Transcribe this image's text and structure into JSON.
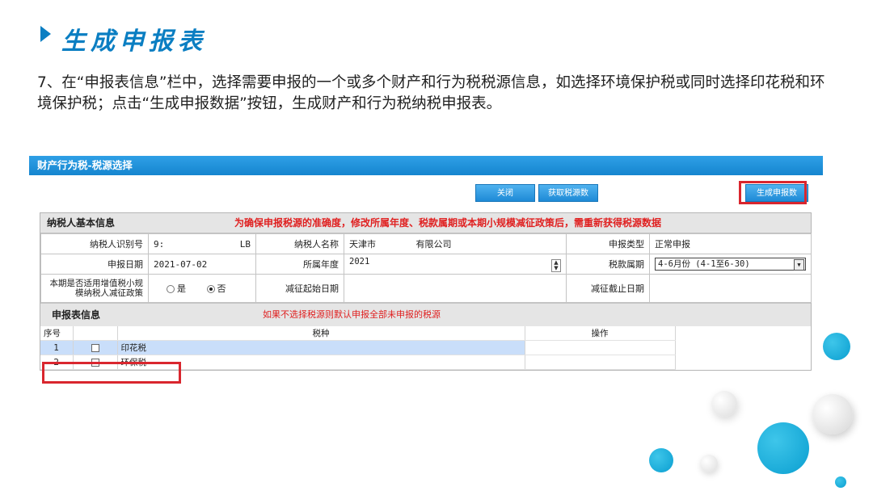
{
  "slide": {
    "title": "生成申报表",
    "description": "7、在“申报表信息”栏中，选择需要申报的一个或多个财产和行为税税源信息，如选择环境保护税或同时选择印花税和环境保护税；点击“生成申报数据”按钮，生成财产和行为税纳税申报表。"
  },
  "window": {
    "title": "财产行为税-税源选择",
    "buttons": {
      "close": "关闭",
      "fetch": "获取税源数据",
      "generate": "生成申报数据"
    }
  },
  "taxpayer": {
    "section_title": "纳税人基本信息",
    "warning": "为确保申报税源的准确度，修改所属年度、税款属期或本期小规模减征政策后，需重新获得税源数据",
    "id_label": "纳税人识别号",
    "id_value_prefix": "9:",
    "id_value_suffix": "LB",
    "name_label": "纳税人名称",
    "name_value_city": "天津市",
    "name_value_company": "有限公司",
    "declare_type_label": "申报类型",
    "declare_type_value": "正常申报",
    "date_label": "申报日期",
    "date_value": "2021-07-02",
    "year_label": "所属年度",
    "year_value": "2021",
    "period_label": "税款属期",
    "period_value": "4-6月份 (4-1至6-30)",
    "policy_label": "本期是否适用增值税小规模纳税人减征政策",
    "policy_yes": "是",
    "policy_no": "否",
    "policy_selected": "否",
    "reduce_start_label": "减征起始日期",
    "reduce_start_value": "",
    "reduce_end_label": "减征截止日期",
    "reduce_end_value": ""
  },
  "declaration": {
    "section_title": "申报表信息",
    "note": "如果不选择税源则默认申报全部未申报的税源",
    "columns": {
      "seq": "序号",
      "tax_type": "税种",
      "action": "操作"
    },
    "rows": [
      {
        "seq": "1",
        "tax_type": "印花税",
        "checked": false,
        "selected": true
      },
      {
        "seq": "2",
        "tax_type": "环保税",
        "checked": false,
        "selected": false
      }
    ]
  },
  "colors": {
    "accent": "#0a7ec2",
    "highlight": "#d9262e",
    "warning": "#e02020",
    "row_selected": "#c9defa"
  }
}
